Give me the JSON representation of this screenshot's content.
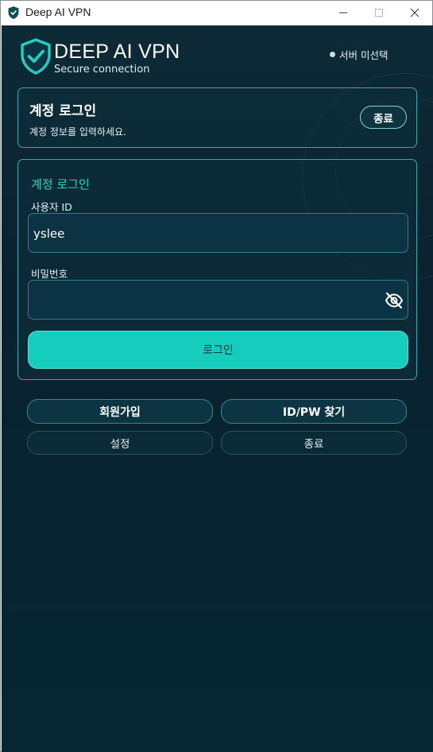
{
  "window": {
    "title": "Deep AI VPN"
  },
  "brand": {
    "name": "DEEP AI VPN",
    "subtitle": "Secure connection",
    "accent_color": "#16ccbc"
  },
  "server_select": {
    "label": "서버 미선택"
  },
  "header_card": {
    "title": "계정 로그인",
    "subtitle": "계정 정보를 입력하세요.",
    "exit_label": "종료"
  },
  "login_form": {
    "title": "계정 로그인",
    "username_label": "사용자 ID",
    "username_value": "yslee",
    "password_label": "비밀번호",
    "password_value": "",
    "password_toggle_icon": "eye-off-icon",
    "submit_label": "로그인"
  },
  "actions": {
    "signup_label": "회원가입",
    "find_label": "ID/PW 찾기",
    "settings_label": "설정",
    "exit_label": "종료"
  }
}
